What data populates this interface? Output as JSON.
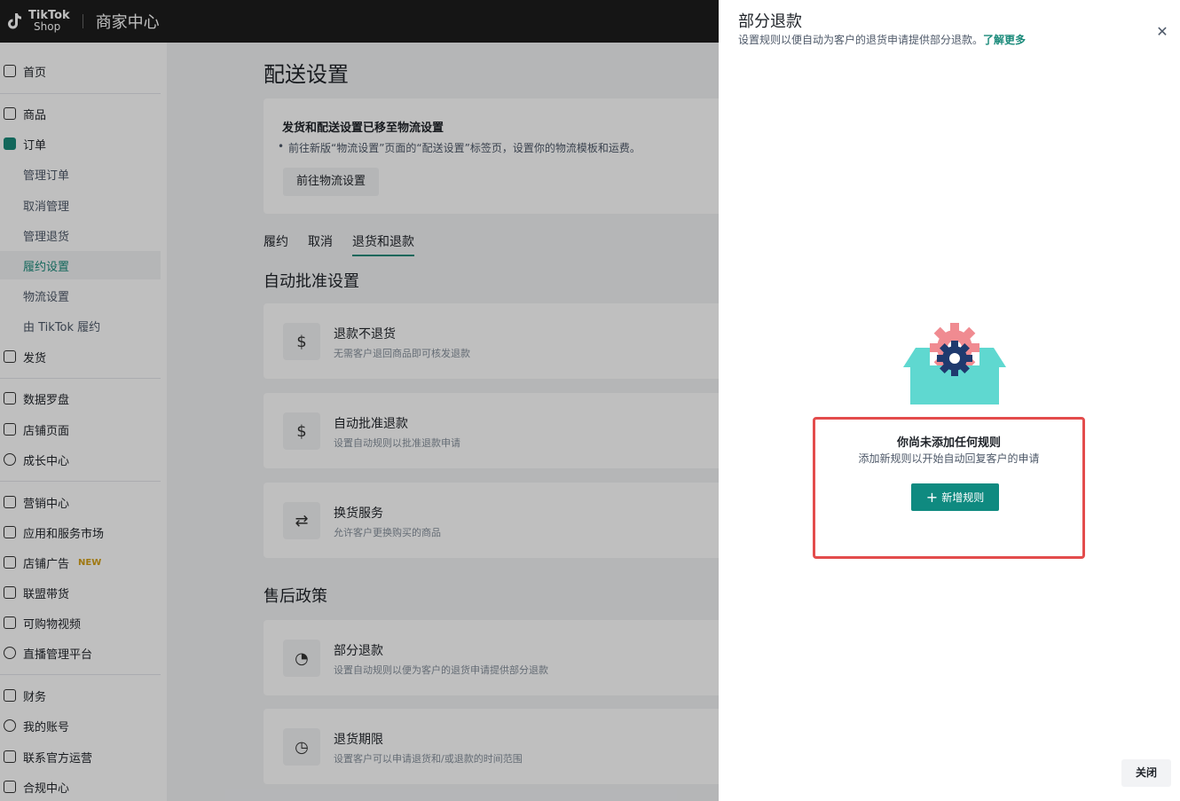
{
  "topbar": {
    "logo_line1": "TikTok",
    "logo_line2": "Shop",
    "title": "商家中心"
  },
  "sidebar": {
    "items": [
      {
        "label": "首页",
        "icon": "home-icon"
      },
      {
        "label": "商品",
        "icon": "bag-icon"
      },
      {
        "label": "订单",
        "icon": "order-icon"
      },
      {
        "label": "管理订单"
      },
      {
        "label": "取消管理"
      },
      {
        "label": "管理退货"
      },
      {
        "label": "履约设置"
      },
      {
        "label": "物流设置"
      },
      {
        "label": "由 TikTok 履约"
      },
      {
        "label": "发货",
        "icon": "truck-icon"
      },
      {
        "label": "数据罗盘",
        "icon": "compass-icon"
      },
      {
        "label": "店铺页面",
        "icon": "store-icon"
      },
      {
        "label": "成长中心",
        "icon": "medal-icon"
      },
      {
        "label": "营销中心",
        "icon": "megaphone-icon"
      },
      {
        "label": "应用和服务市场",
        "icon": "apps-icon"
      },
      {
        "label": "店铺广告",
        "icon": "ad-icon",
        "badge": "NEW"
      },
      {
        "label": "联盟带货",
        "icon": "users-icon"
      },
      {
        "label": "可购物视频",
        "icon": "video-icon"
      },
      {
        "label": "直播管理平台",
        "icon": "live-icon"
      },
      {
        "label": "财务",
        "icon": "wallet-icon"
      },
      {
        "label": "我的账号",
        "icon": "user-icon"
      },
      {
        "label": "联系官方运营",
        "icon": "chat-icon"
      },
      {
        "label": "合规中心",
        "icon": "doc-icon"
      }
    ]
  },
  "main": {
    "title": "配送设置",
    "notice": {
      "heading": "发货和配送设置已移至物流设置",
      "body": "前往新版“物流设置”页面的“配送设置”标签页，设置你的物流模板和运费。",
      "button": "前往物流设置"
    },
    "tabs": [
      "履约",
      "取消",
      "退货和退款"
    ],
    "section1": "自动批准设置",
    "section2": "售后政策",
    "cards": [
      {
        "title": "退款不退货",
        "desc": "无需客户退回商品即可核发退款"
      },
      {
        "title": "自动批准退款",
        "desc": "设置自动规则以批准退款申请"
      },
      {
        "title": "换货服务",
        "desc": "允许客户更换购买的商品"
      },
      {
        "title": "部分退款",
        "desc": "设置自动规则以便为客户的退货申请提供部分退款"
      },
      {
        "title": "退货期限",
        "desc": "设置客户可以申请退货和/或退款的时间范围"
      }
    ]
  },
  "drawer": {
    "title": "部分退款",
    "subtitle": "设置规则以便自动为客户的退货申请提供部分退款。",
    "learn_more": "了解更多",
    "empty_title": "你尚未添加任何规则",
    "empty_desc": "添加新规则以开始自动回复客户的申请",
    "add_button": "新增规则",
    "close_button": "关闭"
  },
  "colors": {
    "accent": "#0f8a80",
    "highlight": "#e34c4c"
  }
}
